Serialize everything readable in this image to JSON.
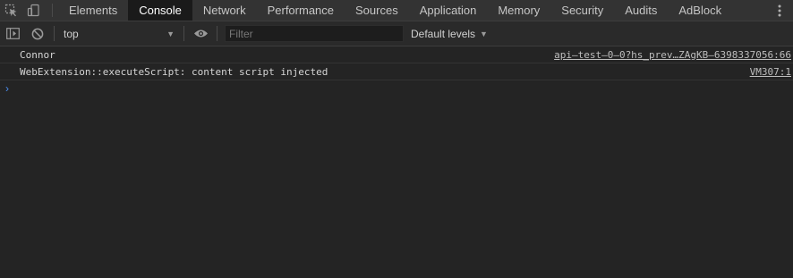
{
  "tabbar": {
    "tabs": [
      "Elements",
      "Console",
      "Network",
      "Performance",
      "Sources",
      "Application",
      "Memory",
      "Security",
      "Audits",
      "AdBlock"
    ],
    "active": "Console"
  },
  "toolbar": {
    "context": "top",
    "filter_placeholder": "Filter",
    "levels_label": "Default levels"
  },
  "console": {
    "messages": [
      {
        "text": "Connor",
        "source": "api–test–0–0?hs_prev…ZAgKB–6398337056:66"
      },
      {
        "text": "WebExtension::executeScript: content script injected",
        "source": "VM307:1"
      }
    ],
    "prompt_symbol": "›"
  },
  "colors": {
    "background": "#242424",
    "tabbar": "#333333",
    "active_tab": "#1a1a1a",
    "prompt": "#4b8ef1"
  }
}
